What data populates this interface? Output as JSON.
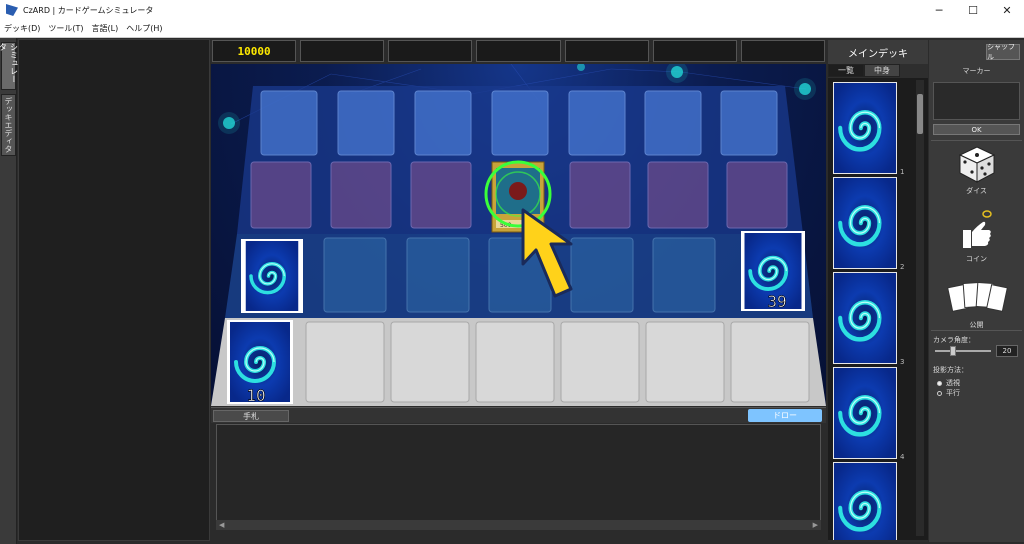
{
  "window": {
    "title": "CzARD | カードゲームシミュレータ",
    "minimize": "─",
    "maximize": "☐",
    "close": "✕"
  },
  "menu": [
    "デッキ(D)",
    "ツール(T)",
    "言語(L)",
    "ヘルプ(H)"
  ],
  "side_tabs": [
    "シミュレータ",
    "デッキエディタ"
  ],
  "life_points": [
    "10000",
    "",
    "",
    "",
    "",
    "",
    ""
  ],
  "board": {
    "deck_count": "39",
    "hand_deck_count": "10",
    "center_card_value": "500"
  },
  "hand": {
    "tab_label": "手札",
    "draw_label": "ドロー"
  },
  "deck_panel": {
    "title": "メインデッキ",
    "tabs": [
      "一覧",
      "中身"
    ],
    "card_numbers": [
      "1",
      "2",
      "3",
      "4"
    ]
  },
  "right_panel": {
    "shuffle_label": "シャッフル",
    "marker_label": "マーカー",
    "ok_label": "OK",
    "dice_label": "ダイス",
    "coin_label": "コイン",
    "reveal_label": "公開",
    "camera_label": "カメラ角度：",
    "camera_value": "20",
    "camera_level": 0.3,
    "projection_label": "投影方法：",
    "projection_options": [
      "透視",
      "平行"
    ],
    "projection_selected": "透視"
  },
  "colors": {
    "accent_yellow": "#ffea00",
    "swirl_cyan": "#2de0e0",
    "card_blue": "#1234a8",
    "draw_button": "#7ec4ff"
  }
}
